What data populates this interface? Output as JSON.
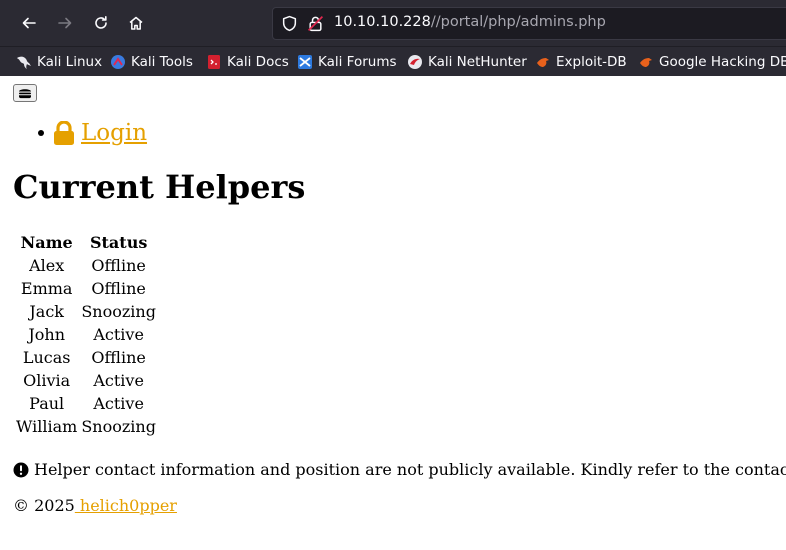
{
  "browser": {
    "url_host": "10.10.10.228",
    "url_path": "//portal/php/admins.php",
    "bookmarks": [
      {
        "label": "Kali Linux",
        "icon": "kali-dragon-icon"
      },
      {
        "label": "Kali Tools",
        "icon": "kali-tools-icon"
      },
      {
        "label": "Kali Docs",
        "icon": "kali-docs-icon"
      },
      {
        "label": "Kali Forums",
        "icon": "kali-forums-icon"
      },
      {
        "label": "Kali NetHunter",
        "icon": "kali-nethunter-icon"
      },
      {
        "label": "Exploit-DB",
        "icon": "exploit-db-icon"
      },
      {
        "label": "Google Hacking DB",
        "icon": "google-hacking-db-icon"
      }
    ]
  },
  "page": {
    "nav_login": " Login",
    "title": "Current Helpers",
    "table": {
      "headers": [
        "Name",
        "Status"
      ],
      "rows": [
        [
          "Alex",
          "Offline"
        ],
        [
          "Emma",
          "Offline"
        ],
        [
          "Jack",
          "Snoozing"
        ],
        [
          "John",
          "Active"
        ],
        [
          "Lucas",
          "Offline"
        ],
        [
          "Olivia",
          "Active"
        ],
        [
          "Paul",
          "Active"
        ],
        [
          "William",
          "Snoozing"
        ]
      ]
    },
    "notice": "Helper contact information and position are not publicly available. Kindly refer to the contact",
    "footer_prefix": "© 2025",
    "footer_link": " helich0pper"
  },
  "colors": {
    "link": "#e5a000",
    "chrome_bg": "#2b2a33"
  }
}
